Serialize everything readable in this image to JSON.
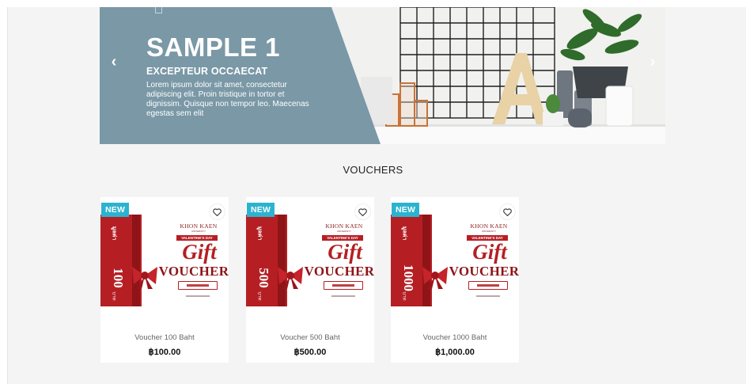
{
  "slider": {
    "title": "SAMPLE 1",
    "subtitle": "EXCEPTEUR OCCAECAT",
    "body": "Lorem ipsum dolor sit amet, consectetur adipiscing elit. Proin tristique in tortor et dignissim. Quisque non tempor leo. Maecenas egestas sem elit",
    "prev_icon": "chevron-left-icon",
    "next_icon": "chevron-right-icon",
    "prev_glyph": "‹",
    "next_glyph": "›",
    "panel_color": "#7a98a6"
  },
  "section": {
    "title": "VOUCHERS"
  },
  "products": [
    {
      "badge": "NEW",
      "name": "Voucher 100 Baht",
      "price": "฿100.00",
      "amount": "100"
    },
    {
      "badge": "NEW",
      "name": "Voucher 500 Baht",
      "price": "฿500.00",
      "amount": "500"
    },
    {
      "badge": "NEW",
      "name": "Voucher 1000 Baht",
      "price": "฿1,000.00",
      "amount": "1000"
    }
  ],
  "voucher_art": {
    "value_label": "มูลค่า",
    "currency_word": "บาท",
    "university": "KHON KAEN",
    "university_sub": "UNIVERSITY",
    "occasion": "VALENTINE'S DAY",
    "gift": "Gift",
    "voucher": "VOUCHER"
  },
  "colors": {
    "accent": "#2bb3cf",
    "voucher_red": "#b51f24"
  }
}
